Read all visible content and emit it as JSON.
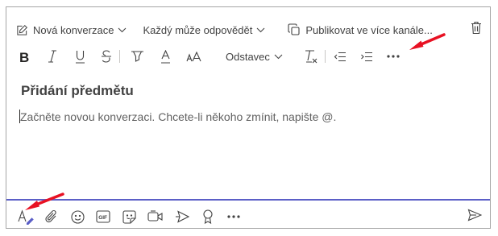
{
  "toolbar_top": {
    "new_conversation": "Nová konverzace",
    "who_can_reply": "Každý může odpovědět",
    "publish": "Publikovat ve více kanále..."
  },
  "format_bar": {
    "paragraph_style": "Odstavec",
    "bold_icon": "bold-icon",
    "italic_icon": "italic-icon",
    "underline_icon": "underline-icon",
    "strikethrough_icon": "strikethrough-icon"
  },
  "editor": {
    "subject_placeholder": "Přidání předmětu",
    "body_placeholder": "Začněte novou konverzaci. Chcete-li někoho zmínit, napište @."
  },
  "colors": {
    "accent": "#5b5fc7",
    "annotation_arrow": "#e81123"
  }
}
